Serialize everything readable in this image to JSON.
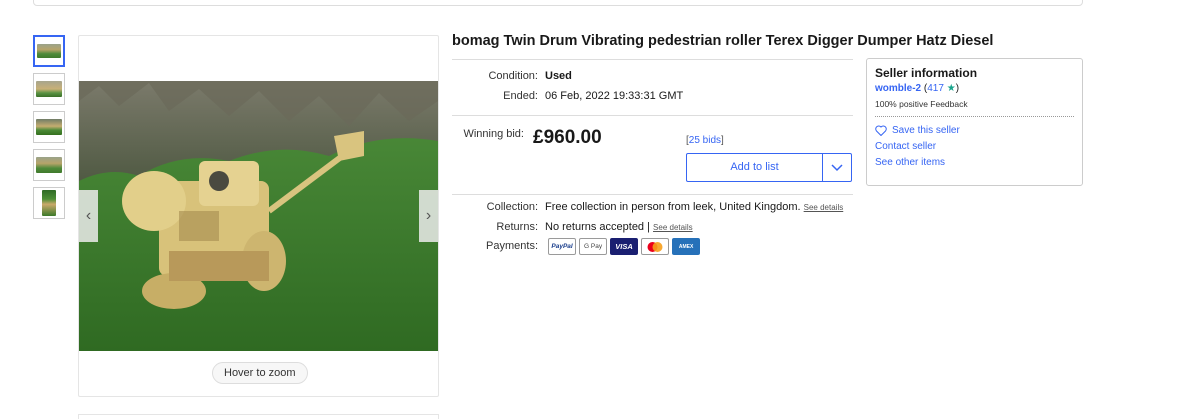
{
  "listing": {
    "title": "bomag Twin Drum Vibrating pedestrian roller Terex Digger Dumper Hatz Diesel",
    "condition_label": "Condition:",
    "condition_value": "Used",
    "ended_label": "Ended:",
    "ended_value": "06 Feb, 2022  19:33:31 GMT",
    "bid_label": "Winning bid:",
    "price": "£960.00",
    "bids_open": "[",
    "bids_text": "25 bids",
    "bids_close": "]",
    "add_to_list": "Add to list",
    "collection_label": "Collection:",
    "collection_value": "Free collection in person from leek, United Kingdom.",
    "see_details": "See details",
    "returns_label": "Returns:",
    "returns_value": "No returns accepted |",
    "payments_label": "Payments:",
    "payment_methods": [
      "PayPal",
      "G Pay",
      "VISA",
      "mastercard",
      "AMEX"
    ]
  },
  "gallery": {
    "zoom_hint": "Hover to zoom",
    "thumbnail_count": 5
  },
  "seller": {
    "heading": "Seller information",
    "name": "womble-2",
    "feedback_score": "417",
    "positive_feedback": "100% positive Feedback",
    "save_seller": "Save this seller",
    "contact_seller": "Contact seller",
    "other_items": "See other items"
  },
  "colors": {
    "link_blue": "#3665f3",
    "star_teal": "#18a48c",
    "text": "#191919"
  }
}
